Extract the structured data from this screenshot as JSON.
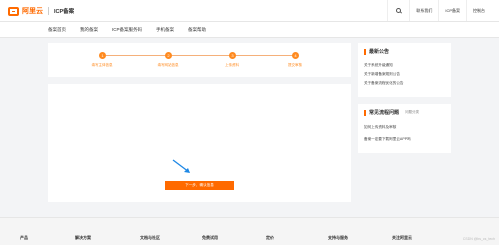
{
  "header": {
    "logo_text": "阿里云",
    "title": "ICP备案",
    "nav_right": [
      "联系我们",
      "ICP备案",
      "控制台"
    ]
  },
  "nav": {
    "items": [
      "备案首页",
      "我的备案",
      "ICP备案服务码",
      "手机备案",
      "备案帮助"
    ]
  },
  "steps": [
    {
      "num": "1",
      "label": "填写主体信息"
    },
    {
      "num": "2",
      "label": "填写网站信息"
    },
    {
      "num": "3",
      "label": "上传资料"
    },
    {
      "num": "4",
      "label": "提交审核"
    }
  ],
  "primary_button": "下一步，确认信息",
  "announcements": {
    "title": "最新公告",
    "items": [
      "关于系统升级通知",
      "关于新增备案规则公告",
      "关于备案流程优化的公告"
    ]
  },
  "faq": {
    "title": "常见流程问题",
    "tag": "问题分类",
    "items": [
      "如何上传资料及审核",
      "备案一定要下载阿里云APP吗"
    ]
  },
  "footer": {
    "columns": [
      "产品",
      "解决方案",
      "文档与社区",
      "免费试用",
      "定价",
      "支持与服务",
      "关注阿里云"
    ],
    "watermark": "CSDN @bs_cs_tech"
  }
}
